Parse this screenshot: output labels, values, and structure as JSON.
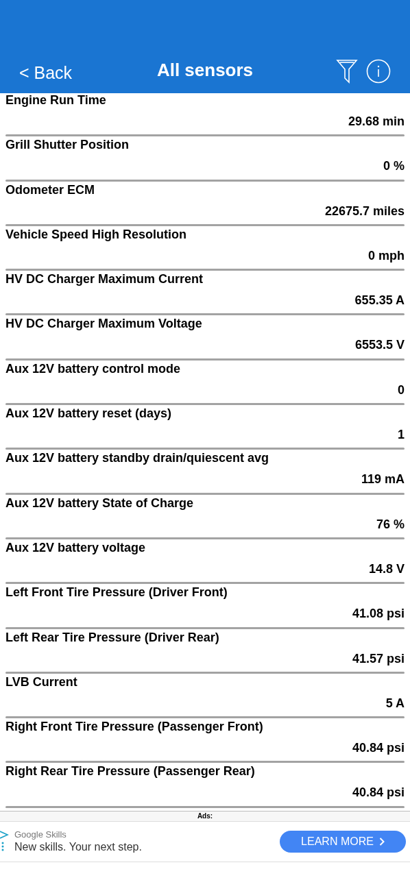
{
  "header": {
    "back": "< Back",
    "title": "All sensors"
  },
  "sensors": [
    {
      "name": "Engine Run Time",
      "value": "29.68 min"
    },
    {
      "name": "Grill Shutter Position",
      "value": "0 %"
    },
    {
      "name": "Odometer ECM",
      "value": "22675.7 miles"
    },
    {
      "name": "Vehicle Speed High Resolution",
      "value": "0 mph"
    },
    {
      "name": "HV DC Charger Maximum Current",
      "value": "655.35 A"
    },
    {
      "name": "HV DC Charger Maximum Voltage",
      "value": "6553.5 V"
    },
    {
      "name": "Aux 12V battery control mode",
      "value": "0"
    },
    {
      "name": "Aux 12V battery reset (days)",
      "value": "1"
    },
    {
      "name": "Aux 12V battery standby drain/quiescent avg",
      "value": "119 mA"
    },
    {
      "name": "Aux 12V battery State of Charge",
      "value": "76 %"
    },
    {
      "name": "Aux 12V battery voltage",
      "value": "14.8 V"
    },
    {
      "name": "Left Front Tire Pressure (Driver Front)",
      "value": "41.08 psi"
    },
    {
      "name": "Left Rear Tire Pressure (Driver Rear)",
      "value": "41.57 psi"
    },
    {
      "name": "LVB Current",
      "value": "5 A"
    },
    {
      "name": "Right Front Tire Pressure (Passenger Front)",
      "value": "40.84 psi"
    },
    {
      "name": "Right Rear Tire Pressure (Passenger Rear)",
      "value": "40.84 psi"
    }
  ],
  "ads": {
    "label": "Ads:",
    "advertiser": "Google Skills",
    "headline": "New skills. Your next step.",
    "button": "LEARN MORE"
  }
}
